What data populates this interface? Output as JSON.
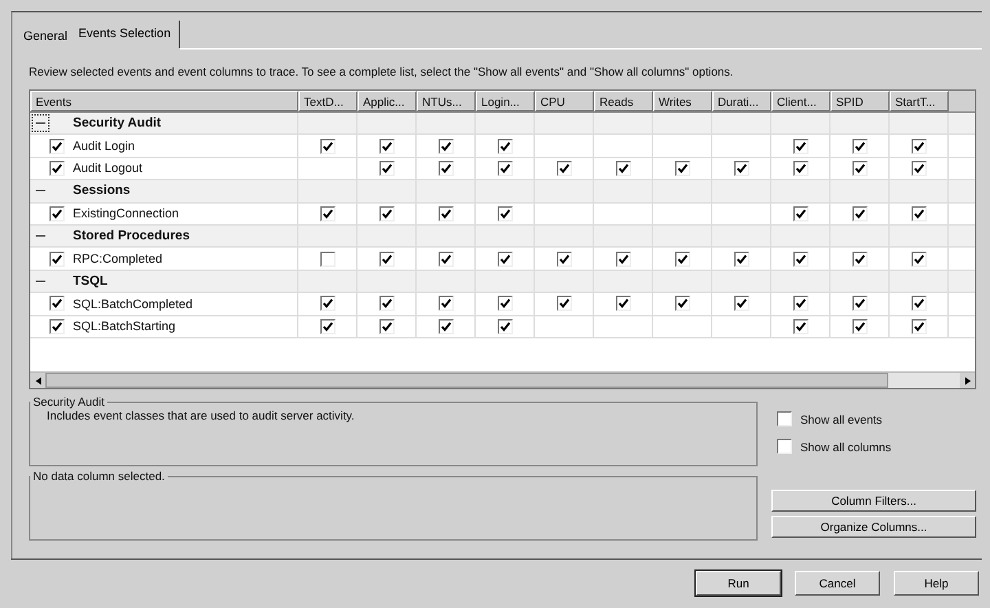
{
  "tabs": [
    {
      "label": "General",
      "selected": false
    },
    {
      "label": "Events Selection",
      "selected": true
    }
  ],
  "instructions": "Review selected events and event columns to trace. To see a complete list, select the \"Show all events\" and \"Show all columns\" options.",
  "grid": {
    "columns": [
      "Events",
      "TextD...",
      "Applic...",
      "NTUs...",
      "Login...",
      "CPU",
      "Reads",
      "Writes",
      "Durati...",
      "Client...",
      "SPID",
      "StartT..."
    ],
    "rows": [
      {
        "kind": "category",
        "label": "Security Audit",
        "expanded": true,
        "focused": true
      },
      {
        "kind": "event",
        "label": "Audit Login",
        "checked": true,
        "cells": [
          {
            "kind": "box",
            "checked": true
          },
          {
            "kind": "box",
            "checked": true
          },
          {
            "kind": "box",
            "checked": true
          },
          {
            "kind": "box",
            "checked": true
          },
          {
            "kind": "blank"
          },
          {
            "kind": "blank"
          },
          {
            "kind": "blank"
          },
          {
            "kind": "blank"
          },
          {
            "kind": "box",
            "checked": true
          },
          {
            "kind": "box",
            "checked": true
          },
          {
            "kind": "box",
            "checked": true
          }
        ]
      },
      {
        "kind": "event",
        "label": "Audit Logout",
        "checked": true,
        "cells": [
          {
            "kind": "blank"
          },
          {
            "kind": "box",
            "checked": true
          },
          {
            "kind": "box",
            "checked": true
          },
          {
            "kind": "box",
            "checked": true
          },
          {
            "kind": "box",
            "checked": true
          },
          {
            "kind": "box",
            "checked": true
          },
          {
            "kind": "box",
            "checked": true
          },
          {
            "kind": "box",
            "checked": true
          },
          {
            "kind": "box",
            "checked": true
          },
          {
            "kind": "box",
            "checked": true
          },
          {
            "kind": "box",
            "checked": true
          }
        ]
      },
      {
        "kind": "category",
        "label": "Sessions",
        "expanded": true,
        "focused": false
      },
      {
        "kind": "event",
        "label": "ExistingConnection",
        "checked": true,
        "cells": [
          {
            "kind": "box",
            "checked": true
          },
          {
            "kind": "box",
            "checked": true
          },
          {
            "kind": "box",
            "checked": true
          },
          {
            "kind": "box",
            "checked": true
          },
          {
            "kind": "blank"
          },
          {
            "kind": "blank"
          },
          {
            "kind": "blank"
          },
          {
            "kind": "blank"
          },
          {
            "kind": "box",
            "checked": true
          },
          {
            "kind": "box",
            "checked": true
          },
          {
            "kind": "box",
            "checked": true
          }
        ]
      },
      {
        "kind": "category",
        "label": "Stored Procedures",
        "expanded": true,
        "focused": false
      },
      {
        "kind": "event",
        "label": "RPC:Completed",
        "checked": true,
        "cells": [
          {
            "kind": "box",
            "checked": false
          },
          {
            "kind": "box",
            "checked": true
          },
          {
            "kind": "box",
            "checked": true
          },
          {
            "kind": "box",
            "checked": true
          },
          {
            "kind": "box",
            "checked": true
          },
          {
            "kind": "box",
            "checked": true
          },
          {
            "kind": "box",
            "checked": true
          },
          {
            "kind": "box",
            "checked": true
          },
          {
            "kind": "box",
            "checked": true
          },
          {
            "kind": "box",
            "checked": true
          },
          {
            "kind": "box",
            "checked": true
          }
        ]
      },
      {
        "kind": "category",
        "label": "TSQL",
        "expanded": true,
        "focused": false
      },
      {
        "kind": "event",
        "label": "SQL:BatchCompleted",
        "checked": true,
        "cells": [
          {
            "kind": "box",
            "checked": true
          },
          {
            "kind": "box",
            "checked": true
          },
          {
            "kind": "box",
            "checked": true
          },
          {
            "kind": "box",
            "checked": true
          },
          {
            "kind": "box",
            "checked": true
          },
          {
            "kind": "box",
            "checked": true
          },
          {
            "kind": "box",
            "checked": true
          },
          {
            "kind": "box",
            "checked": true
          },
          {
            "kind": "box",
            "checked": true
          },
          {
            "kind": "box",
            "checked": true
          },
          {
            "kind": "box",
            "checked": true
          }
        ]
      },
      {
        "kind": "event",
        "label": "SQL:BatchStarting",
        "checked": true,
        "cells": [
          {
            "kind": "box",
            "checked": true
          },
          {
            "kind": "box",
            "checked": true
          },
          {
            "kind": "box",
            "checked": true
          },
          {
            "kind": "box",
            "checked": true
          },
          {
            "kind": "blank"
          },
          {
            "kind": "blank"
          },
          {
            "kind": "blank"
          },
          {
            "kind": "blank"
          },
          {
            "kind": "box",
            "checked": true
          },
          {
            "kind": "box",
            "checked": true
          },
          {
            "kind": "box",
            "checked": true
          }
        ]
      }
    ]
  },
  "event_description": {
    "title": "Security Audit",
    "text": "Includes event classes that are used to audit server activity."
  },
  "options": [
    {
      "label": "Show all events",
      "checked": false
    },
    {
      "label": "Show all columns",
      "checked": false
    }
  ],
  "column_description": {
    "title": "No data column selected."
  },
  "side_buttons": [
    "Column Filters...",
    "Organize Columns..."
  ],
  "footer_buttons": [
    {
      "label": "Run",
      "default": true
    },
    {
      "label": "Cancel",
      "default": false
    },
    {
      "label": "Help",
      "default": false
    }
  ]
}
